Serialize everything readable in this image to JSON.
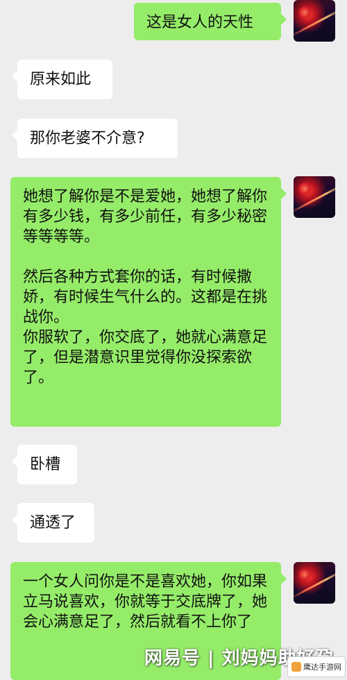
{
  "messages": [
    {
      "side": "out",
      "text": "这是女人的天性"
    },
    {
      "side": "in",
      "text": "原来如此"
    },
    {
      "side": "in",
      "text": "那你老婆不介意?"
    },
    {
      "side": "out",
      "text": "她想了解你是不是爱她，她想了解你有多少钱，有多少前任，有多少秘密等等等等。\n\n然后各种方式套你的话，有时候撒娇，有时候生气什么的。这都是在挑战你。\n你服软了，你交底了，她就心满意足了，但是潜意识里觉得你没探索欲了。"
    },
    {
      "side": "in",
      "text": "卧槽"
    },
    {
      "side": "in",
      "text": "通透了"
    },
    {
      "side": "out",
      "text": "一个女人问你是不是喜欢她，你如果立马说喜欢，你就等于交底牌了，她会心满意足了，然后就看不上你了"
    }
  ],
  "watermark": "网易号 | 刘妈妈助好孕",
  "site_badge": "鹰达手游网"
}
